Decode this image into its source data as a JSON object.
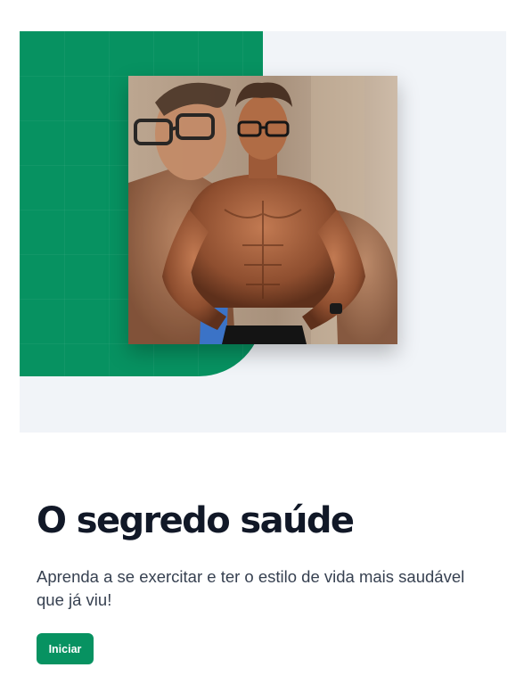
{
  "hero": {
    "image_alt": "Homem musculoso de óculos",
    "colors": {
      "accent": "#079261",
      "panel_background": "#f1f4f8"
    }
  },
  "content": {
    "headline": "O segredo saúde",
    "subtitle": "Aprenda a se exercitar e ter o estilo de vida mais saudável que já viu!",
    "cta_label": "Iniciar"
  }
}
